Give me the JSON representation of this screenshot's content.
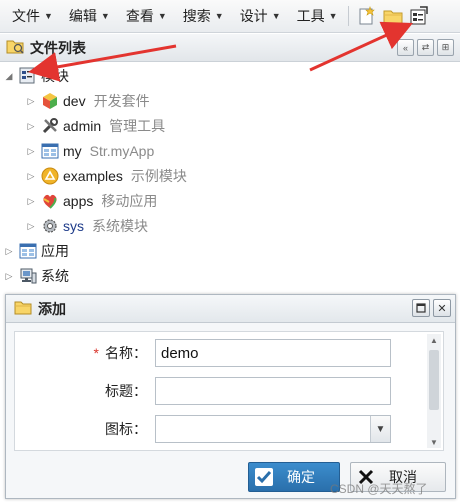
{
  "menu": {
    "items": [
      {
        "label": "文件",
        "name": "menu-file"
      },
      {
        "label": "编辑",
        "name": "menu-edit"
      },
      {
        "label": "查看",
        "name": "menu-view"
      },
      {
        "label": "搜索",
        "name": "menu-search"
      },
      {
        "label": "设计",
        "name": "menu-design"
      },
      {
        "label": "工具",
        "name": "menu-tools"
      }
    ],
    "toolbar_icons": [
      "new-file-icon",
      "open-folder-icon",
      "properties-icon"
    ]
  },
  "panel": {
    "title": "文件列表",
    "tools": [
      "collapse-all-icon",
      "refresh-icon",
      "link-icon"
    ]
  },
  "tree": {
    "root": {
      "label": "模块",
      "icon": "modules-icon"
    },
    "children": [
      {
        "name": "dev",
        "desc": "开发套件",
        "icon": "cube-icon"
      },
      {
        "name": "admin",
        "desc": "管理工具",
        "icon": "tools-icon"
      },
      {
        "name": "my",
        "desc": "Str.myApp",
        "icon": "window-icon"
      },
      {
        "name": "examples",
        "desc": "示例模块",
        "icon": "examples-icon"
      },
      {
        "name": "apps",
        "desc": "移动应用",
        "icon": "apps-icon"
      },
      {
        "name": "sys",
        "desc": "系统模块",
        "icon": "gear-icon"
      }
    ],
    "others": [
      {
        "label": "应用",
        "icon": "application-icon"
      },
      {
        "label": "系统",
        "icon": "system-icon"
      }
    ]
  },
  "dialog": {
    "title": "添加",
    "fields": {
      "name_label": "名称：",
      "name_value": "demo",
      "title_label": "标题：",
      "title_value": "",
      "icon_label": "图标：",
      "icon_value": ""
    },
    "required_mark": "*",
    "ok_label": "确定",
    "cancel_label": "取消"
  },
  "watermark": "CSDN @天天熬了",
  "colors": {
    "accent": "#2e7bbf",
    "arrow": "#e3342f",
    "required": "#d9342b"
  }
}
